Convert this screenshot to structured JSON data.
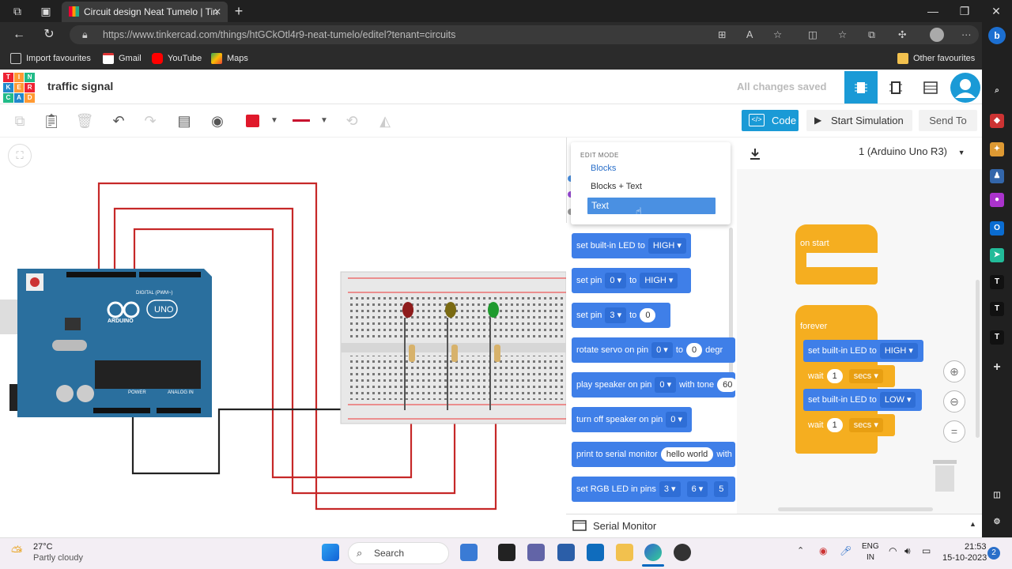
{
  "browser": {
    "tab_title": "Circuit design Neat Tumelo | Tin",
    "url_host": "https://www.tinkercad.com",
    "url_path": "/things/htGCkOtl4r9-neat-tumelo/editel?tenant=circuits",
    "favourites": [
      "Import favourites",
      "Gmail",
      "YouTube",
      "Maps"
    ],
    "other_favourites": "Other favourites"
  },
  "app": {
    "logo": [
      "TIN",
      "KER",
      "CAD"
    ],
    "project_title": "traffic signal",
    "save_status": "All changes saved",
    "code_label": "Code",
    "sim_label": "Start Simulation",
    "send_label": "Send To"
  },
  "code_panel": {
    "device": "1 (Arduino Uno R3)",
    "edit_mode": {
      "header": "EDIT MODE",
      "options": [
        "Blocks",
        "Blocks + Text",
        "Text"
      ],
      "selected": "Text"
    },
    "palette": [
      {
        "parts": [
          "set built-in LED to"
        ],
        "dd": [
          "HIGH"
        ]
      },
      {
        "parts": [
          "set pin",
          "to"
        ],
        "dd": [
          "0",
          "HIGH"
        ]
      },
      {
        "parts": [
          "set pin",
          "to"
        ],
        "dd": [
          "3"
        ],
        "num": "0"
      },
      {
        "parts": [
          "rotate servo on pin",
          "to",
          "degr"
        ],
        "dd": [
          "0"
        ],
        "num": "0"
      },
      {
        "parts": [
          "play speaker on pin",
          "with tone"
        ],
        "dd": [
          "0"
        ],
        "num": "60"
      },
      {
        "parts": [
          "turn off speaker on pin"
        ],
        "dd": [
          "0"
        ]
      },
      {
        "parts": [
          "print to serial monitor",
          "with"
        ],
        "num": "hello world"
      },
      {
        "parts": [
          "set RGB LED in pins"
        ],
        "dd": [
          "3",
          "6",
          "5"
        ]
      }
    ],
    "workspace": {
      "on_start": "on start",
      "forever": "forever",
      "led_high": "set built-in LED to",
      "led_high_val": "HIGH",
      "wait1": "wait",
      "wait1_val": "1",
      "wait1_unit": "secs",
      "led_low": "set built-in LED to",
      "led_low_val": "LOW",
      "wait2": "wait",
      "wait2_val": "1",
      "wait2_unit": "secs"
    },
    "serial_monitor": "Serial Monitor"
  },
  "board": {
    "label_digital": "DIGITAL (PWM~)",
    "label_uno": "UNO",
    "label_arduino": "ARDUINO",
    "label_power": "POWER",
    "label_analog": "ANALOG IN"
  },
  "taskbar": {
    "temp": "27°C",
    "weather": "Partly cloudy",
    "search": "Search",
    "lang1": "ENG",
    "lang2": "IN",
    "time": "21:53",
    "date": "15-10-2023",
    "notif": "2"
  },
  "colors": {
    "accent": "#1a9ad6",
    "block_blue": "#3f7fe8",
    "block_yellow": "#f5ae20",
    "wire_red": "#c62828",
    "board": "#2a6f9e"
  }
}
